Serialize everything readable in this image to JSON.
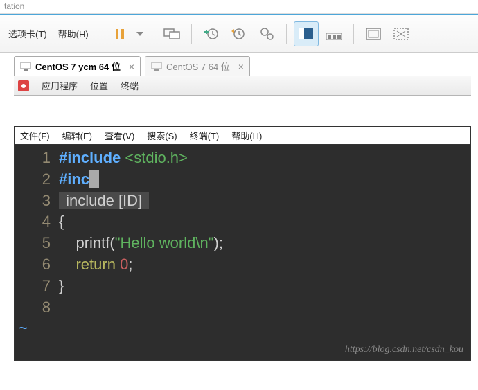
{
  "window": {
    "title_fragment": "tation"
  },
  "toolbar": {
    "menu": [
      {
        "label": "选项卡(T)"
      },
      {
        "label": "帮助(H)"
      }
    ]
  },
  "vm_tabs": [
    {
      "label": "CentOS 7 ycm 64 位",
      "active": true
    },
    {
      "label": "CentOS 7 64 位",
      "active": false
    }
  ],
  "gnome": {
    "items": [
      "应用程序",
      "位置",
      "终端"
    ]
  },
  "terminal_menu": [
    "文件(F)",
    "编辑(E)",
    "查看(V)",
    "搜索(S)",
    "终端(T)",
    "帮助(H)"
  ],
  "code": {
    "l1_dir": "#include",
    "l1_inc": "<stdio.h>",
    "l2_dir": "#inc",
    "l3_hl": " include [ID] ",
    "l4": "{",
    "l5_fn": "printf",
    "l5_str": "\"Hello world\\n\"",
    "l5_post": ");",
    "l6_kw": "return",
    "l6_num": "0",
    "l6_post": ";",
    "l7": "}"
  },
  "gutters": [
    "1",
    "2",
    "3",
    "4",
    "5",
    "6",
    "7",
    "8"
  ],
  "watermark": "https://blog.csdn.net/csdn_kou"
}
